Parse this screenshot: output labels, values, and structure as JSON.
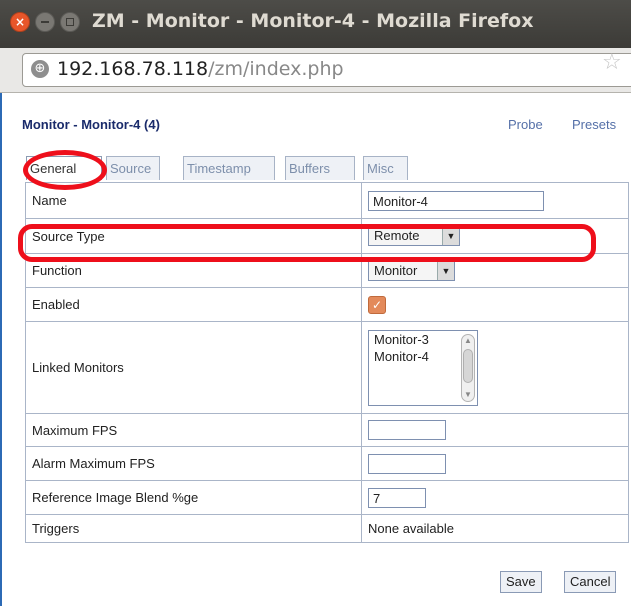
{
  "window": {
    "title": "ZM - Monitor - Monitor-4 - Mozilla Firefox"
  },
  "urlbar": {
    "host": "192.168.78.118",
    "path": "/zm/index.php"
  },
  "page": {
    "heading": "Monitor - Monitor-4 (4)",
    "links": {
      "probe": "Probe",
      "presets": "Presets"
    },
    "tabs": [
      "General",
      "Source",
      "Timestamp",
      "Buffers",
      "Misc"
    ],
    "active_tab": "General",
    "fields": {
      "name": {
        "label": "Name",
        "value": "Monitor-4"
      },
      "source_type": {
        "label": "Source Type",
        "value": "Remote"
      },
      "function": {
        "label": "Function",
        "value": "Monitor"
      },
      "enabled": {
        "label": "Enabled",
        "checked": true
      },
      "linked_monitors": {
        "label": "Linked Monitors",
        "options": [
          "Monitor-3",
          "Monitor-4"
        ]
      },
      "max_fps": {
        "label": "Maximum FPS",
        "value": ""
      },
      "alarm_max_fps": {
        "label": "Alarm Maximum FPS",
        "value": ""
      },
      "ref_blend": {
        "label": "Reference Image Blend %ge",
        "value": "7"
      },
      "triggers": {
        "label": "Triggers",
        "value": "None available"
      }
    },
    "buttons": {
      "save": "Save",
      "cancel": "Cancel"
    }
  },
  "colors": {
    "annotation_red": "#ee0f1b",
    "titlebar": "#3c3b37",
    "close_button": "#e8562a"
  }
}
